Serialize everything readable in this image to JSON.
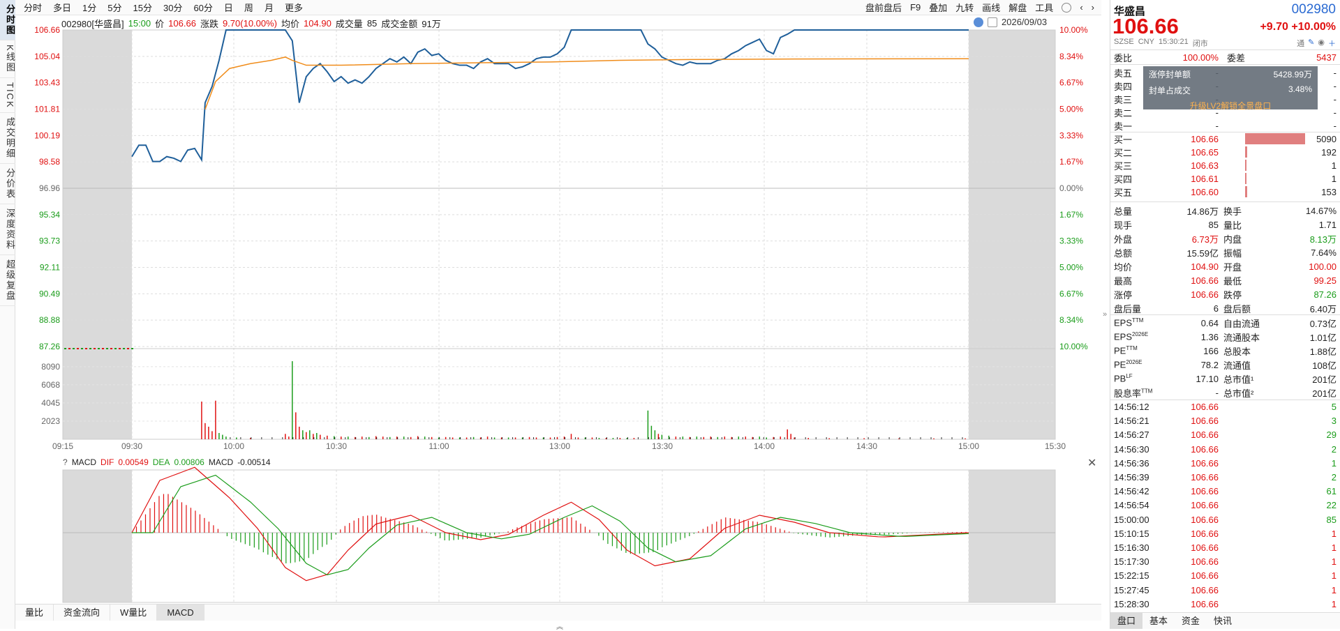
{
  "toolbar": {
    "periods": [
      "分时",
      "多日",
      "1分",
      "5分",
      "15分",
      "30分",
      "60分",
      "日",
      "周",
      "月",
      "更多"
    ],
    "tools": [
      "盘前盘后",
      "F9",
      "叠加",
      "九转",
      "画线",
      "解盘",
      "工具"
    ]
  },
  "vtabs": [
    "分时图",
    "K线图",
    "TICK",
    "成交明细",
    "分价表",
    "深度资料",
    "超级复盘"
  ],
  "info": {
    "code_name": "002980[华盛昌]",
    "time": "15:00",
    "price_label": "价",
    "price": "106.66",
    "chg_label": "涨跌",
    "chg": "9.70(10.00%)",
    "avg_label": "均价",
    "avg": "104.90",
    "vol_label": "成交量",
    "vol": "85",
    "amt_label": "成交金额",
    "amt": "91万",
    "date": "2026/09/03"
  },
  "chart_data": {
    "type": "line",
    "title": "",
    "price_axis": [
      "106.66",
      "105.04",
      "103.43",
      "101.81",
      "100.19",
      "98.58",
      "96.96",
      "95.34",
      "93.73",
      "92.11",
      "90.49",
      "88.88",
      "87.26"
    ],
    "pct_axis": [
      "10.00%",
      "8.34%",
      "6.67%",
      "5.00%",
      "3.33%",
      "1.67%",
      "0.00%",
      "1.67%",
      "3.33%",
      "5.00%",
      "6.67%",
      "8.34%",
      "10.00%"
    ],
    "vol_axis": [
      "8090",
      "6068",
      "4045",
      "2023"
    ],
    "time_labels": [
      "09:15",
      "09:30",
      "10:00",
      "10:30",
      "11:00",
      "13:00",
      "13:30",
      "14:00",
      "14:30",
      "15:00",
      "15:30"
    ],
    "prev_close": 96.96,
    "ylim": [
      87.26,
      106.66
    ],
    "price_series": [
      [
        0,
        98.9
      ],
      [
        2,
        99.6
      ],
      [
        4,
        99.6
      ],
      [
        6,
        98.6
      ],
      [
        8,
        98.6
      ],
      [
        10,
        98.9
      ],
      [
        12,
        98.8
      ],
      [
        14,
        98.6
      ],
      [
        16,
        99.3
      ],
      [
        18,
        99.4
      ],
      [
        20,
        98.7
      ],
      [
        21,
        102.2
      ],
      [
        23,
        103.2
      ],
      [
        25,
        104.8
      ],
      [
        27,
        106.66
      ],
      [
        40,
        106.66
      ],
      [
        44,
        106.66
      ],
      [
        46,
        106.0
      ],
      [
        48,
        102.2
      ],
      [
        50,
        103.8
      ],
      [
        52,
        104.3
      ],
      [
        54,
        104.6
      ],
      [
        56,
        104.1
      ],
      [
        58,
        103.5
      ],
      [
        60,
        103.8
      ],
      [
        62,
        103.4
      ],
      [
        64,
        103.6
      ],
      [
        66,
        103.4
      ],
      [
        68,
        103.8
      ],
      [
        70,
        104.3
      ],
      [
        72,
        104.6
      ],
      [
        74,
        104.9
      ],
      [
        76,
        104.7
      ],
      [
        78,
        105.0
      ],
      [
        80,
        104.6
      ],
      [
        82,
        105.3
      ],
      [
        84,
        105.5
      ],
      [
        86,
        105.1
      ],
      [
        88,
        105.2
      ],
      [
        90,
        104.8
      ],
      [
        92,
        104.6
      ],
      [
        94,
        104.5
      ],
      [
        96,
        104.5
      ],
      [
        98,
        104.3
      ],
      [
        100,
        104.7
      ],
      [
        102,
        104.9
      ],
      [
        104,
        104.6
      ],
      [
        106,
        104.6
      ],
      [
        108,
        104.6
      ],
      [
        110,
        104.3
      ],
      [
        112,
        104.4
      ],
      [
        114,
        104.6
      ],
      [
        116,
        104.9
      ],
      [
        118,
        105.0
      ],
      [
        120,
        105.0
      ],
      [
        122,
        105.2
      ],
      [
        124,
        105.6
      ],
      [
        126,
        106.66
      ],
      [
        140,
        106.66
      ],
      [
        146,
        106.66
      ],
      [
        148,
        105.8
      ],
      [
        150,
        105.5
      ],
      [
        152,
        105.0
      ],
      [
        154,
        104.8
      ],
      [
        156,
        104.6
      ],
      [
        158,
        104.5
      ],
      [
        160,
        104.7
      ],
      [
        162,
        104.6
      ],
      [
        164,
        104.6
      ],
      [
        166,
        104.6
      ],
      [
        168,
        104.8
      ],
      [
        170,
        104.9
      ],
      [
        172,
        105.2
      ],
      [
        174,
        105.4
      ],
      [
        176,
        105.7
      ],
      [
        178,
        105.9
      ],
      [
        180,
        106.1
      ],
      [
        182,
        105.4
      ],
      [
        184,
        105.2
      ],
      [
        186,
        106.2
      ],
      [
        188,
        106.4
      ],
      [
        190,
        106.66
      ],
      [
        240,
        106.66
      ]
    ],
    "avg_series": [
      [
        21,
        101.8
      ],
      [
        24,
        103.5
      ],
      [
        28,
        104.3
      ],
      [
        34,
        104.6
      ],
      [
        40,
        104.8
      ],
      [
        44,
        105.0
      ],
      [
        46,
        104.8
      ],
      [
        50,
        104.5
      ],
      [
        60,
        104.5
      ],
      [
        80,
        104.6
      ],
      [
        100,
        104.65
      ],
      [
        120,
        104.7
      ],
      [
        140,
        104.8
      ],
      [
        160,
        104.85
      ],
      [
        190,
        104.88
      ],
      [
        240,
        104.9
      ]
    ],
    "volume_bars": [
      {
        "i": 20,
        "v": 4200,
        "c": "r"
      },
      {
        "i": 21,
        "v": 1800,
        "c": "r"
      },
      {
        "i": 22,
        "v": 1400,
        "c": "r"
      },
      {
        "i": 23,
        "v": 900,
        "c": "r"
      },
      {
        "i": 24,
        "v": 4300,
        "c": "r"
      },
      {
        "i": 25,
        "v": 700,
        "c": "g"
      },
      {
        "i": 26,
        "v": 500,
        "c": "g"
      },
      {
        "i": 27,
        "v": 300,
        "c": "g"
      },
      {
        "i": 30,
        "v": 200,
        "c": "g"
      },
      {
        "i": 34,
        "v": 150,
        "c": "r"
      },
      {
        "i": 44,
        "v": 600,
        "c": "r"
      },
      {
        "i": 45,
        "v": 300,
        "c": "r"
      },
      {
        "i": 46,
        "v": 8700,
        "c": "g"
      },
      {
        "i": 47,
        "v": 3000,
        "c": "r"
      },
      {
        "i": 48,
        "v": 1400,
        "c": "r"
      },
      {
        "i": 49,
        "v": 1000,
        "c": "g"
      },
      {
        "i": 50,
        "v": 800,
        "c": "r"
      },
      {
        "i": 51,
        "v": 1000,
        "c": "g"
      },
      {
        "i": 52,
        "v": 600,
        "c": "r"
      },
      {
        "i": 53,
        "v": 700,
        "c": "g"
      },
      {
        "i": 54,
        "v": 500,
        "c": "r"
      },
      {
        "i": 56,
        "v": 400,
        "c": "r"
      },
      {
        "i": 58,
        "v": 350,
        "c": "g"
      },
      {
        "i": 60,
        "v": 300,
        "c": "r"
      },
      {
        "i": 62,
        "v": 300,
        "c": "g"
      },
      {
        "i": 64,
        "v": 250,
        "c": "r"
      },
      {
        "i": 66,
        "v": 300,
        "c": "r"
      },
      {
        "i": 68,
        "v": 250,
        "c": "g"
      },
      {
        "i": 70,
        "v": 350,
        "c": "r"
      },
      {
        "i": 72,
        "v": 300,
        "c": "r"
      },
      {
        "i": 74,
        "v": 250,
        "c": "g"
      },
      {
        "i": 76,
        "v": 300,
        "c": "r"
      },
      {
        "i": 78,
        "v": 300,
        "c": "g"
      },
      {
        "i": 80,
        "v": 250,
        "c": "r"
      },
      {
        "i": 82,
        "v": 350,
        "c": "r"
      },
      {
        "i": 84,
        "v": 300,
        "c": "g"
      },
      {
        "i": 86,
        "v": 250,
        "c": "r"
      },
      {
        "i": 88,
        "v": 200,
        "c": "g"
      },
      {
        "i": 90,
        "v": 250,
        "c": "r"
      },
      {
        "i": 92,
        "v": 200,
        "c": "r"
      },
      {
        "i": 94,
        "v": 200,
        "c": "g"
      },
      {
        "i": 96,
        "v": 200,
        "c": "r"
      },
      {
        "i": 98,
        "v": 250,
        "c": "g"
      },
      {
        "i": 100,
        "v": 200,
        "c": "r"
      },
      {
        "i": 102,
        "v": 300,
        "c": "r"
      },
      {
        "i": 104,
        "v": 200,
        "c": "g"
      },
      {
        "i": 106,
        "v": 200,
        "c": "r"
      },
      {
        "i": 108,
        "v": 200,
        "c": "g"
      },
      {
        "i": 110,
        "v": 200,
        "c": "r"
      },
      {
        "i": 112,
        "v": 200,
        "c": "g"
      },
      {
        "i": 114,
        "v": 250,
        "c": "r"
      },
      {
        "i": 116,
        "v": 200,
        "c": "r"
      },
      {
        "i": 118,
        "v": 200,
        "c": "g"
      },
      {
        "i": 120,
        "v": 200,
        "c": "r"
      },
      {
        "i": 122,
        "v": 250,
        "c": "r"
      },
      {
        "i": 124,
        "v": 300,
        "c": "r"
      },
      {
        "i": 126,
        "v": 600,
        "c": "r"
      },
      {
        "i": 128,
        "v": 200,
        "c": "r"
      },
      {
        "i": 130,
        "v": 200,
        "c": "g"
      },
      {
        "i": 132,
        "v": 200,
        "c": "r"
      },
      {
        "i": 134,
        "v": 150,
        "c": "g"
      },
      {
        "i": 136,
        "v": 150,
        "c": "r"
      },
      {
        "i": 138,
        "v": 150,
        "c": "g"
      },
      {
        "i": 140,
        "v": 150,
        "c": "r"
      },
      {
        "i": 142,
        "v": 150,
        "c": "g"
      },
      {
        "i": 144,
        "v": 150,
        "c": "r"
      },
      {
        "i": 148,
        "v": 3200,
        "c": "g"
      },
      {
        "i": 149,
        "v": 1500,
        "c": "g"
      },
      {
        "i": 150,
        "v": 1000,
        "c": "g"
      },
      {
        "i": 151,
        "v": 600,
        "c": "r"
      },
      {
        "i": 152,
        "v": 500,
        "c": "g"
      },
      {
        "i": 154,
        "v": 400,
        "c": "g"
      },
      {
        "i": 156,
        "v": 300,
        "c": "r"
      },
      {
        "i": 158,
        "v": 300,
        "c": "g"
      },
      {
        "i": 160,
        "v": 250,
        "c": "r"
      },
      {
        "i": 162,
        "v": 300,
        "c": "g"
      },
      {
        "i": 164,
        "v": 250,
        "c": "r"
      },
      {
        "i": 166,
        "v": 300,
        "c": "r"
      },
      {
        "i": 168,
        "v": 250,
        "c": "g"
      },
      {
        "i": 170,
        "v": 300,
        "c": "r"
      },
      {
        "i": 172,
        "v": 250,
        "c": "r"
      },
      {
        "i": 174,
        "v": 300,
        "c": "g"
      },
      {
        "i": 176,
        "v": 300,
        "c": "r"
      },
      {
        "i": 178,
        "v": 250,
        "c": "r"
      },
      {
        "i": 180,
        "v": 300,
        "c": "g"
      },
      {
        "i": 182,
        "v": 200,
        "c": "g"
      },
      {
        "i": 184,
        "v": 250,
        "c": "r"
      },
      {
        "i": 186,
        "v": 300,
        "c": "r"
      },
      {
        "i": 188,
        "v": 1100,
        "c": "r"
      },
      {
        "i": 189,
        "v": 600,
        "c": "r"
      },
      {
        "i": 190,
        "v": 200,
        "c": "r"
      },
      {
        "i": 194,
        "v": 150,
        "c": "r"
      },
      {
        "i": 200,
        "v": 120,
        "c": "r"
      },
      {
        "i": 210,
        "v": 120,
        "c": "r"
      },
      {
        "i": 220,
        "v": 100,
        "c": "r"
      },
      {
        "i": 230,
        "v": 100,
        "c": "r"
      },
      {
        "i": 239,
        "v": 100,
        "c": "r"
      }
    ],
    "macd": {
      "dif_label": "DIF",
      "dif": "0.00549",
      "dea_label": "DEA",
      "dea": "0.00806",
      "macd_label": "MACD",
      "macd": "-0.00514"
    }
  },
  "right": {
    "name": "华盛昌",
    "code": "002980",
    "price": "106.66",
    "chg": "+9.70",
    "pct": "+10.00%",
    "market": "SZSE",
    "currency": "CNY",
    "time": "15:30:21",
    "status": "闭市",
    "tong": "通",
    "weibi_label": "委比",
    "weibi": "100.00%",
    "weicha_label": "委差",
    "weicha": "5437",
    "asks": [
      {
        "label": "卖五",
        "price": "-",
        "vol": "-"
      },
      {
        "label": "卖四",
        "price": "-",
        "vol": "-"
      },
      {
        "label": "卖三",
        "price": "-",
        "vol": "-"
      },
      {
        "label": "卖二",
        "price": "-",
        "vol": "-"
      },
      {
        "label": "卖一",
        "price": "-",
        "vol": "-"
      }
    ],
    "overlay": {
      "seal_amt_label": "涨停封单额",
      "seal_amt": "5428.99万",
      "seal_ratio_label": "封单占成交",
      "seal_ratio": "3.48%",
      "upgrade": "升级LV2解锁全景盘口"
    },
    "bids": [
      {
        "label": "买一",
        "price": "106.66",
        "vol": "5090",
        "ratio": 1.0
      },
      {
        "label": "买二",
        "price": "106.65",
        "vol": "192",
        "ratio": 0.04
      },
      {
        "label": "买三",
        "price": "106.63",
        "vol": "1",
        "ratio": 0.01
      },
      {
        "label": "买四",
        "price": "106.61",
        "vol": "1",
        "ratio": 0.01
      },
      {
        "label": "买五",
        "price": "106.60",
        "vol": "153",
        "ratio": 0.03
      }
    ],
    "stats": [
      {
        "k1": "总量",
        "v1": "14.86万",
        "c1": "",
        "k2": "换手",
        "v2": "14.67%",
        "c2": ""
      },
      {
        "k1": "现手",
        "v1": "85",
        "c1": "",
        "k2": "量比",
        "v2": "1.71",
        "c2": ""
      },
      {
        "k1": "外盘",
        "v1": "6.73万",
        "c1": "red",
        "k2": "内盘",
        "v2": "8.13万",
        "c2": "green"
      },
      {
        "k1": "总额",
        "v1": "15.59亿",
        "c1": "",
        "k2": "振幅",
        "v2": "7.64%",
        "c2": ""
      },
      {
        "k1": "均价",
        "v1": "104.90",
        "c1": "red",
        "k2": "开盘",
        "v2": "100.00",
        "c2": "red"
      },
      {
        "k1": "最高",
        "v1": "106.66",
        "c1": "red",
        "k2": "最低",
        "v2": "99.25",
        "c2": "red"
      },
      {
        "k1": "涨停",
        "v1": "106.66",
        "c1": "red",
        "k2": "跌停",
        "v2": "87.26",
        "c2": "green"
      },
      {
        "k1": "盘后量",
        "v1": "6",
        "c1": "",
        "k2": "盘后额",
        "v2": "6.40万",
        "c2": ""
      }
    ],
    "fin": [
      {
        "k1": "EPS",
        "s1": "TTM",
        "v1": "0.64",
        "k2": "自由流通",
        "v2": "0.73亿"
      },
      {
        "k1": "EPS",
        "s1": "2026E",
        "v1": "1.36",
        "k2": "流通股本",
        "v2": "1.01亿"
      },
      {
        "k1": "PE",
        "s1": "TTM",
        "v1": "166",
        "k2": "总股本",
        "v2": "1.88亿"
      },
      {
        "k1": "PE",
        "s1": "2026E",
        "v1": "78.2",
        "k2": "流通值",
        "v2": "108亿"
      },
      {
        "k1": "PB",
        "s1": "LF",
        "v1": "17.10",
        "k2": "总市值¹",
        "v2": "201亿"
      },
      {
        "k1": "股息率",
        "s1": "TTM",
        "v1": "-",
        "k2": "总市值²",
        "v2": "201亿"
      }
    ],
    "ticks": [
      {
        "t": "14:56:12",
        "p": "106.66",
        "v": "5",
        "c": "green"
      },
      {
        "t": "14:56:21",
        "p": "106.66",
        "v": "3",
        "c": "green"
      },
      {
        "t": "14:56:27",
        "p": "106.66",
        "v": "29",
        "c": "green"
      },
      {
        "t": "14:56:30",
        "p": "106.66",
        "v": "2",
        "c": "green"
      },
      {
        "t": "14:56:36",
        "p": "106.66",
        "v": "1",
        "c": "green"
      },
      {
        "t": "14:56:39",
        "p": "106.66",
        "v": "2",
        "c": "green"
      },
      {
        "t": "14:56:42",
        "p": "106.66",
        "v": "61",
        "c": "green"
      },
      {
        "t": "14:56:54",
        "p": "106.66",
        "v": "22",
        "c": "green"
      },
      {
        "t": "15:00:00",
        "p": "106.66",
        "v": "85",
        "c": "green"
      },
      {
        "t": "15:10:15",
        "p": "106.66",
        "v": "1",
        "c": "red"
      },
      {
        "t": "15:16:30",
        "p": "106.66",
        "v": "1",
        "c": "red"
      },
      {
        "t": "15:17:30",
        "p": "106.66",
        "v": "1",
        "c": "red"
      },
      {
        "t": "15:22:15",
        "p": "106.66",
        "v": "1",
        "c": "red"
      },
      {
        "t": "15:27:45",
        "p": "106.66",
        "v": "1",
        "c": "red"
      },
      {
        "t": "15:28:30",
        "p": "106.66",
        "v": "1",
        "c": "red"
      }
    ],
    "tabs": [
      "盘口",
      "基本",
      "资金",
      "快讯"
    ]
  },
  "bottom_tabs": [
    "量比",
    "资金流向",
    "W量比",
    "MACD"
  ],
  "colors": {
    "up": "#e01010",
    "down": "#1a9c1a",
    "price_line": "#1f5f9a",
    "avg_line": "#f08c1a",
    "link": "#2a6ad2"
  }
}
